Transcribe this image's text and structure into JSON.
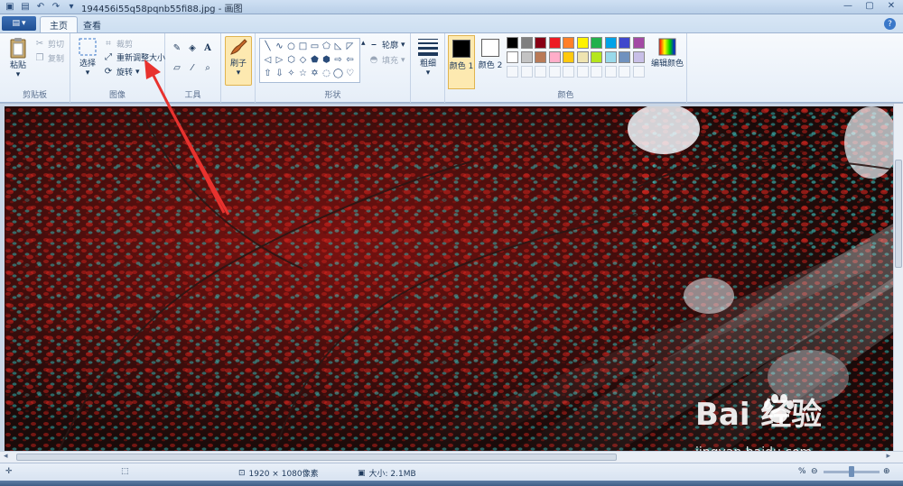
{
  "window": {
    "title": "194456i55q58pqnb55fi88.jpg - 画图",
    "controls": [
      "minimize",
      "maximize",
      "close"
    ]
  },
  "quick_access": [
    "save-icon",
    "undo-icon",
    "redo-icon",
    "dropdown-icon"
  ],
  "tabs": [
    {
      "label": "主页",
      "active": true
    },
    {
      "label": "查看",
      "active": false
    }
  ],
  "ribbon": {
    "clipboard": {
      "label": "剪贴板",
      "paste": "粘贴",
      "cut": "剪切",
      "copy": "复制"
    },
    "image": {
      "label": "图像",
      "select": "选择",
      "crop": "裁剪",
      "resize": "重新调整大小",
      "rotate": "旋转"
    },
    "tools": {
      "label": "工具",
      "brushes": "刷子"
    },
    "shapes": {
      "label": "形状",
      "outline": "轮廓",
      "fill": "填充",
      "glyphs": [
        "╲",
        "∿",
        "○",
        "□",
        "▭",
        "⬠",
        "◺",
        "◸",
        "◁",
        "▷",
        "⬡",
        "◇",
        "⬟",
        "⬢",
        "⇨",
        "⇦",
        "⇧",
        "⇩",
        "✧",
        "☆",
        "✡",
        "◌",
        "◯",
        "♡"
      ]
    },
    "size": {
      "label": "粗细"
    },
    "colors": {
      "label": "颜色",
      "color1": "颜色 1",
      "color2": "颜色 2",
      "color1_value": "#000000",
      "color2_value": "#ffffff",
      "edit": "编辑颜色",
      "palette_row1": [
        "#000000",
        "#7f7f7f",
        "#880015",
        "#ed1c24",
        "#ff7f27",
        "#fff200",
        "#22b14c",
        "#00a2e8",
        "#3f48cc",
        "#a349a4"
      ],
      "palette_row2": [
        "#ffffff",
        "#c3c3c3",
        "#b97a57",
        "#ffaec9",
        "#ffc90e",
        "#efe4b0",
        "#b5e61d",
        "#99d9ea",
        "#7092be",
        "#c8bfe7"
      ]
    }
  },
  "status": {
    "dimensions": "1920 × 1080像素",
    "size": "大小: 2.1MB",
    "zoom": "%"
  },
  "watermark": {
    "brand": "Bai  经验",
    "url": "jingyan.baidu.com"
  },
  "colors": {
    "accent": "#3a78c9",
    "arrow": "#e8322e",
    "foliage_red": "#c0201a",
    "foliage_teal": "#2fb3b0"
  }
}
